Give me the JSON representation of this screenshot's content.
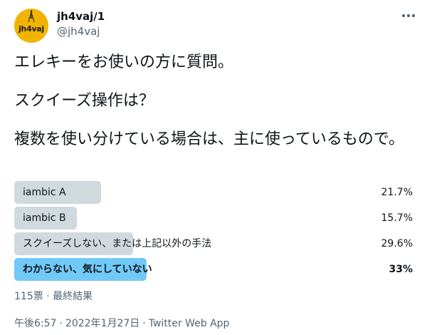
{
  "user": {
    "display_name": "jh4vaj/1",
    "handle": "@jh4vaj",
    "avatar_text": "jh4vaj",
    "avatar_color": "#f0b400"
  },
  "more_icon": "more-horizontal-icon",
  "tweet": {
    "lines": [
      "エレキーをお使いの方に質問。",
      "スクイーズ操作は？",
      "複数を使い分けている場合は、主に使っているもので。"
    ]
  },
  "poll": {
    "options": [
      {
        "label": "iambic A",
        "percent_text": "21.7%",
        "percent": 21.7
      },
      {
        "label": "iambic B",
        "percent_text": "15.7%",
        "percent": 15.7
      },
      {
        "label": "スクイーズしない、または上記以外の手法",
        "percent_text": "29.6%",
        "percent": 29.6
      },
      {
        "label": "わからない、気にしていない",
        "percent_text": "33%",
        "percent": 33
      }
    ],
    "winner_index": 3,
    "bar_color": "#cfd9de",
    "winner_color": "#71c9f8",
    "votes": "115票",
    "status": "最終結果"
  },
  "meta": {
    "time": "午後6:57",
    "date": "2022年1月27日",
    "source": "Twitter Web App"
  },
  "colors": {
    "text": "#0f1419",
    "secondary": "#536471"
  }
}
